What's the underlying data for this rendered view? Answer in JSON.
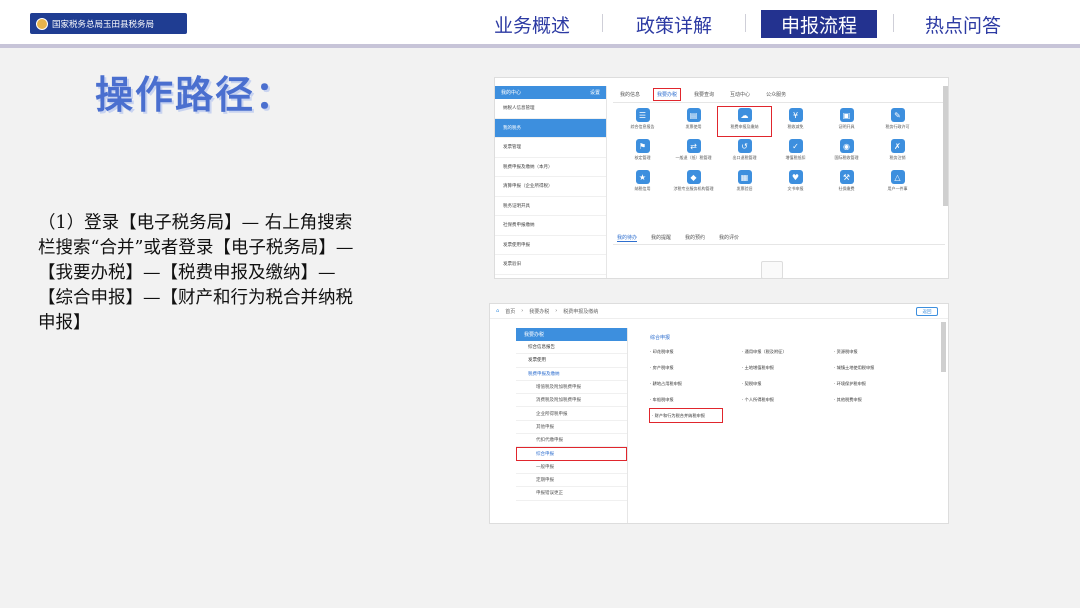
{
  "header": {
    "logo_text": "国家税务总局玉田县税务局",
    "nav": [
      {
        "label": "业务概述",
        "active": false
      },
      {
        "label": "政策详解",
        "active": false
      },
      {
        "label": "申报流程",
        "active": true
      },
      {
        "label": "热点问答",
        "active": false
      }
    ]
  },
  "title": "操作路径：",
  "description": "（1）登录【电子税务局】— 右上角搜索栏搜索“合并”或者登录【电子税务局】—【我要办税】—【税费申报及缴纳】—【综合申报】—【财产和行为税合并纳税申报】",
  "screenshot1": {
    "sidebar_header": "我的中心",
    "sidebar_header_right": "设置",
    "sidebar_items": [
      {
        "label": "纳税人信息管理",
        "blue": false
      },
      {
        "label": "我的税务",
        "blue": true
      },
      {
        "label": "发票管理",
        "blue": false
      },
      {
        "label": "税费申报及缴纳（本月）",
        "blue": false
      },
      {
        "label": "清算申报（企业所得税）",
        "blue": false
      },
      {
        "label": "税务证明开具",
        "blue": false
      },
      {
        "label": "社保费申报缴纳",
        "blue": false
      },
      {
        "label": "发票使用申报",
        "blue": false
      },
      {
        "label": "发票验旧",
        "blue": false
      },
      {
        "label": "纳税人登记信息查询",
        "blue": false
      }
    ],
    "tabs": [
      {
        "label": "我的信息",
        "hl": false
      },
      {
        "label": "我要办税",
        "hl": true
      },
      {
        "label": "我要查询",
        "hl": false
      },
      {
        "label": "互动中心",
        "hl": false
      },
      {
        "label": "公众服务",
        "hl": false
      }
    ],
    "grid": [
      {
        "label": "综合信息报告",
        "glyph": "☰",
        "hl": false
      },
      {
        "label": "发票使用",
        "glyph": "▤",
        "hl": false
      },
      {
        "label": "税费申报及缴纳",
        "glyph": "☁",
        "hl": true
      },
      {
        "label": "税收减免",
        "glyph": "¥",
        "hl": false
      },
      {
        "label": "证明开具",
        "glyph": "▣",
        "hl": false
      },
      {
        "label": "税务行政许可",
        "glyph": "✎",
        "hl": false
      },
      {
        "label": "核定管理",
        "glyph": "⚑",
        "hl": false
      },
      {
        "label": "一般退（抵）税管理",
        "glyph": "⇄",
        "hl": false
      },
      {
        "label": "出口退税管理",
        "glyph": "↺",
        "hl": false
      },
      {
        "label": "增值税抵扣",
        "glyph": "✓",
        "hl": false
      },
      {
        "label": "国际税收管理",
        "glyph": "◉",
        "hl": false
      },
      {
        "label": "税务注销",
        "glyph": "✗",
        "hl": false
      },
      {
        "label": "纳税信用",
        "glyph": "★",
        "hl": false
      },
      {
        "label": "涉税专业服务机构管理",
        "glyph": "◆",
        "hl": false
      },
      {
        "label": "发票验旧",
        "glyph": "▦",
        "hl": false
      },
      {
        "label": "文书申报",
        "glyph": "♥",
        "hl": false
      },
      {
        "label": "社保缴费",
        "glyph": "⚒",
        "hl": false
      },
      {
        "label": "用户一件事",
        "glyph": "△",
        "hl": false
      }
    ],
    "sub_tabs": [
      {
        "label": "我的待办",
        "on": true
      },
      {
        "label": "我的提醒",
        "on": false
      },
      {
        "label": "我的预约",
        "on": false
      },
      {
        "label": "我的评价",
        "on": false
      }
    ]
  },
  "screenshot2": {
    "breadcrumb": [
      "首页",
      "我要办税",
      "税费申报及缴纳"
    ],
    "back_label": "返回",
    "sidebar_header": "我要办税",
    "sidebar_items": [
      {
        "label": "综合信息报告",
        "type": "",
        "hl": false
      },
      {
        "label": "发票使用",
        "type": "",
        "hl": false
      },
      {
        "label": "税费申报及缴纳",
        "type": "blue",
        "hl": false
      },
      {
        "label": "增值税及附加税费申报",
        "type": "sub",
        "hl": false
      },
      {
        "label": "消费税及附加税费申报",
        "type": "sub",
        "hl": false
      },
      {
        "label": "企业所得税申报",
        "type": "sub",
        "hl": false
      },
      {
        "label": "其他申报",
        "type": "sub",
        "hl": false
      },
      {
        "label": "代扣代缴申报",
        "type": "sub",
        "hl": false
      },
      {
        "label": "综合申报",
        "type": "sub",
        "hl": true
      },
      {
        "label": "一般申报",
        "type": "sub",
        "hl": false
      },
      {
        "label": "定期申报",
        "type": "sub",
        "hl": false
      },
      {
        "label": "申报错误更正",
        "type": "sub",
        "hl": false
      }
    ],
    "section_title": "综合申报",
    "grid": [
      {
        "label": "· 印花税申报",
        "hl": false
      },
      {
        "label": "· 通用申报（税及附征）",
        "hl": false
      },
      {
        "label": "· 资源税申报",
        "hl": false
      },
      {
        "label": "· 房产税申报",
        "hl": false
      },
      {
        "label": "· 土地增值税申报",
        "hl": false
      },
      {
        "label": "· 城镇土地使用税申报",
        "hl": false
      },
      {
        "label": "· 耕地占用税申报",
        "hl": false
      },
      {
        "label": "· 契税申报",
        "hl": false
      },
      {
        "label": "· 环境保护税申报",
        "hl": false
      },
      {
        "label": "· 车船税申报",
        "hl": false
      },
      {
        "label": "· 个人所得税申报",
        "hl": false
      },
      {
        "label": "· 其他税费申报",
        "hl": false
      },
      {
        "label": "· 财产和行为税合并纳税申报",
        "hl": true
      }
    ]
  }
}
